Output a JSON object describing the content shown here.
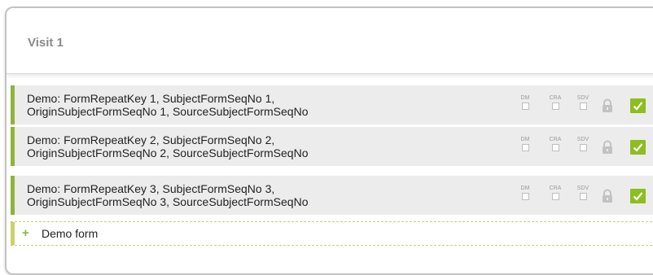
{
  "visit": {
    "title": "Visit 1"
  },
  "forms": [
    {
      "line1": "Demo: FormRepeatKey 1, SubjectFormSeqNo 1,",
      "line2": "OriginSubjectFormSeqNo 1, SourceSubjectFormSeqNo"
    },
    {
      "line1": "Demo: FormRepeatKey 2, SubjectFormSeqNo 2,",
      "line2": "OriginSubjectFormSeqNo 2, SourceSubjectFormSeqNo"
    },
    {
      "line1": "Demo: FormRepeatKey 3, SubjectFormSeqNo 3,",
      "line2": "OriginSubjectFormSeqNo 3, SourceSubjectFormSeqNo"
    }
  ],
  "flags": {
    "dm": "DM",
    "cra": "CRA",
    "sdv": "SDV"
  },
  "add_form": {
    "icon": "+",
    "label": "Demo form"
  },
  "icons": {
    "lock": "lock-icon",
    "complete": "checkmark-icon",
    "add": "plus-icon"
  },
  "colors": {
    "accent_green": "#8dbd1e",
    "row_background": "#ececec",
    "title_gray": "#8a8a8a"
  }
}
